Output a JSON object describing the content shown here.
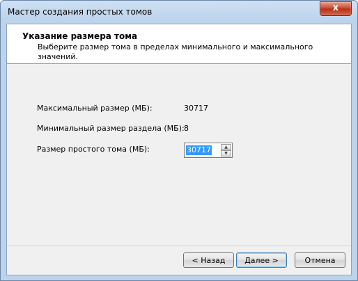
{
  "window": {
    "title": "Мастер создания простых томов",
    "close_glyph": "x"
  },
  "header": {
    "title": "Указание размера тома",
    "subtitle": "Выберите размер тома в пределах минимального и максимального значений."
  },
  "fields": {
    "max_label": "Максимальный размер (МБ):",
    "max_value": "30717",
    "min_label": "Минимальный размер раздела (МБ):",
    "min_value": "8",
    "size_label": "Размер простого тома (МБ):",
    "size_value": "30717",
    "up_glyph": "▲",
    "down_glyph": "▼"
  },
  "buttons": {
    "back": "< Назад",
    "next": "Далее >",
    "cancel": "Отмена"
  }
}
